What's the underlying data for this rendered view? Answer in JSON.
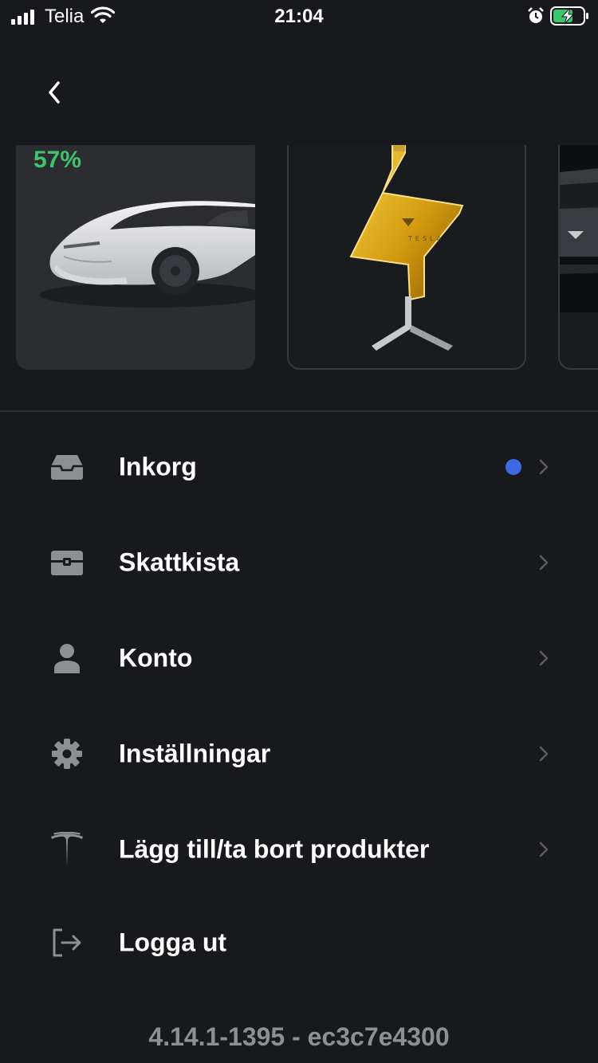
{
  "status_bar": {
    "carrier": "Telia",
    "time": "21:04",
    "icons": [
      "signal-icon",
      "wifi-icon",
      "alarm-icon",
      "battery-charging-icon"
    ]
  },
  "nav": {
    "back_icon": "chevron-left-icon"
  },
  "products": [
    {
      "name": "car",
      "battery_percent": "57%",
      "battery_color": "#3ec46d"
    },
    {
      "name": "decanter"
    },
    {
      "name": "car-partial"
    }
  ],
  "menu": {
    "items": [
      {
        "label": "Inkorg",
        "icon": "inbox-icon",
        "unread": true
      },
      {
        "label": "Skattkista",
        "icon": "treasure-chest-icon"
      },
      {
        "label": "Konto",
        "icon": "user-icon"
      },
      {
        "label": "Inställningar",
        "icon": "gear-icon"
      },
      {
        "label": "Lägg till/ta bort produkter",
        "icon": "tesla-logo-icon"
      },
      {
        "label": "Logga ut",
        "icon": "logout-icon"
      }
    ]
  },
  "footer": {
    "version": "4.14.1-1395 - ec3c7e4300"
  },
  "colors": {
    "background": "#18191c",
    "accent": "#3e6ae1",
    "battery_green": "#3ec46d"
  }
}
